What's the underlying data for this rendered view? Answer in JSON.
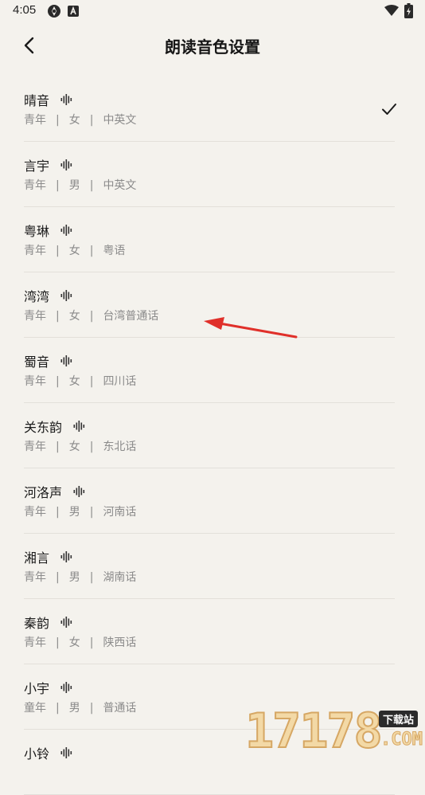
{
  "status_bar": {
    "time": "4:05",
    "icons": [
      "aperture-icon",
      "font-a-icon",
      "wifi-icon",
      "battery-charging-icon"
    ]
  },
  "header": {
    "title": "朗读音色设置",
    "back_icon": "chevron-left-icon"
  },
  "voices": [
    {
      "name": "晴音",
      "age": "青年",
      "gender": "女",
      "language": "中英文",
      "selected": true
    },
    {
      "name": "言宇",
      "age": "青年",
      "gender": "男",
      "language": "中英文",
      "selected": false
    },
    {
      "name": "粤琳",
      "age": "青年",
      "gender": "女",
      "language": "粤语",
      "selected": false
    },
    {
      "name": "湾湾",
      "age": "青年",
      "gender": "女",
      "language": "台湾普通话",
      "selected": false
    },
    {
      "name": "蜀音",
      "age": "青年",
      "gender": "女",
      "language": "四川话",
      "selected": false
    },
    {
      "name": "关东韵",
      "age": "青年",
      "gender": "女",
      "language": "东北话",
      "selected": false
    },
    {
      "name": "河洛声",
      "age": "青年",
      "gender": "男",
      "language": "河南话",
      "selected": false
    },
    {
      "name": "湘言",
      "age": "青年",
      "gender": "男",
      "language": "湖南话",
      "selected": false
    },
    {
      "name": "秦韵",
      "age": "青年",
      "gender": "女",
      "language": "陕西话",
      "selected": false
    },
    {
      "name": "小宇",
      "age": "童年",
      "gender": "男",
      "language": "普通话",
      "selected": false
    },
    {
      "name": "小铃",
      "age": "",
      "gender": "",
      "language": "",
      "selected": false
    }
  ],
  "meta_separator": "|",
  "watermark": {
    "digits": "17178",
    "badge": "下载站",
    "suffix": ".COM"
  },
  "colors": {
    "background": "#f4f2ed",
    "annotation_arrow": "#e0302a",
    "watermark": "#f3d9a6"
  }
}
